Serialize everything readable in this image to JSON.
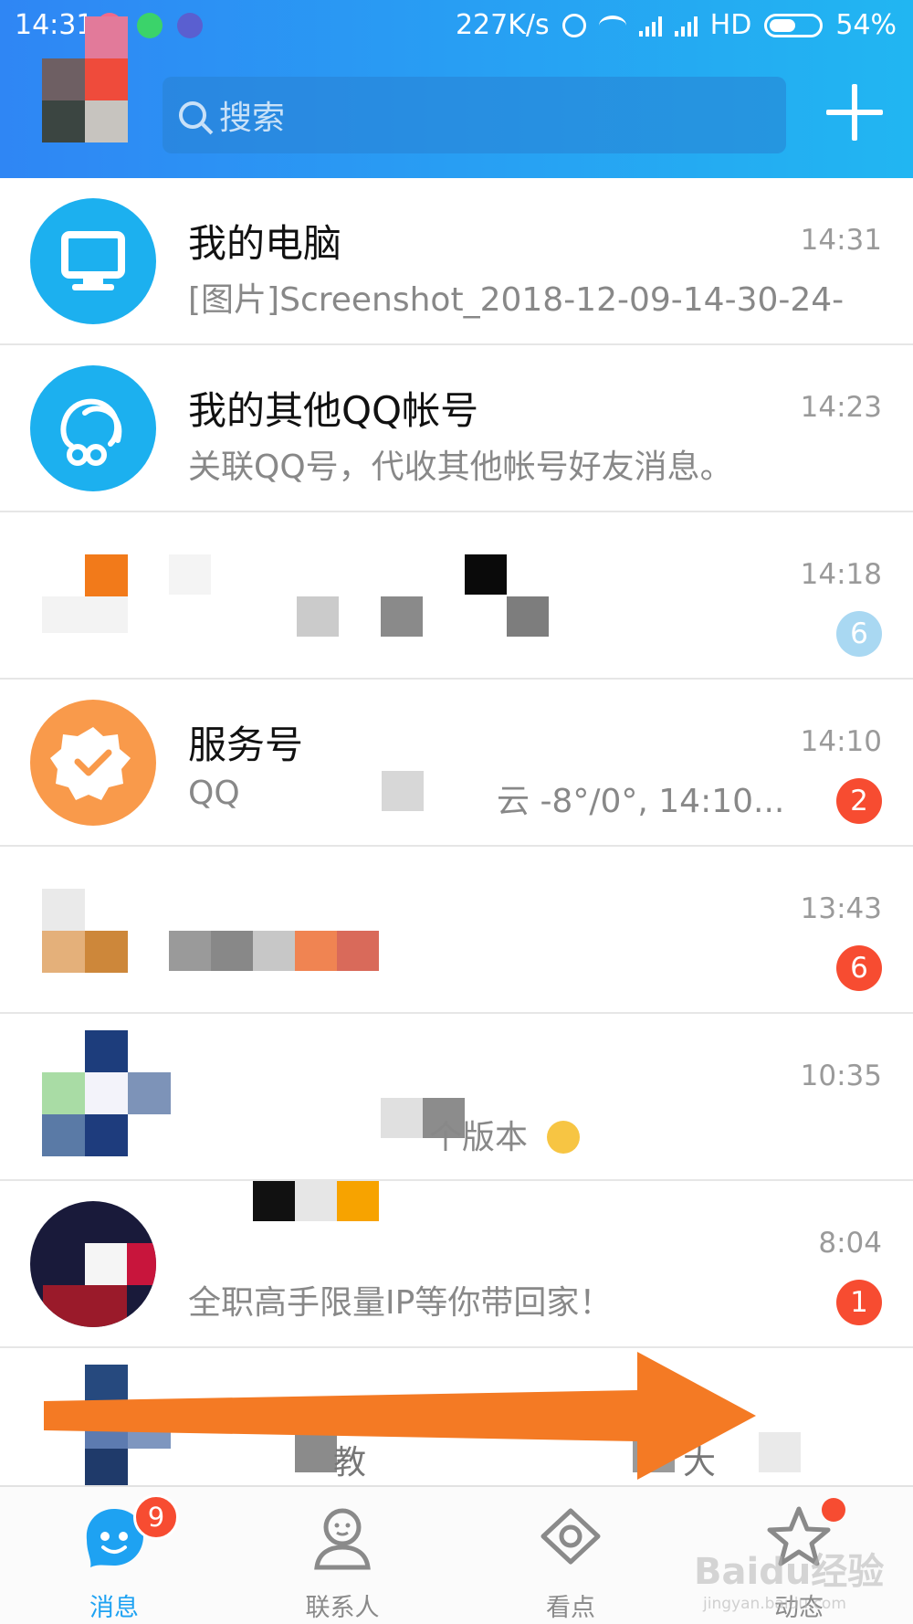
{
  "status_bar": {
    "time": "14:31",
    "net_speed": "227K/s",
    "hd": "HD",
    "battery": "54%",
    "battery_level": 0.54
  },
  "header": {
    "search_placeholder": "搜索"
  },
  "chats": [
    {
      "name": "我的电脑",
      "preview": "[图片]Screenshot_2018-12-09-14-30-24-...",
      "time": "14:31",
      "badge": "",
      "avatar_color": "#1cb0ef",
      "icon": "computer-icon"
    },
    {
      "name": "我的其他QQ帐号",
      "preview": "关联QQ号，代收其他帐号好友消息。",
      "time": "14:23",
      "badge": "",
      "avatar_color": "#1cb0ef",
      "icon": "linked-accounts-icon"
    },
    {
      "name": "",
      "preview": "",
      "time": "14:18",
      "badge": "6",
      "badge_muted": true
    },
    {
      "name": "服务号",
      "preview": "QQ",
      "preview_tail": "云 -8°/0°, 14:10...",
      "time": "14:10",
      "badge": "2",
      "avatar_color": "#f99a4b",
      "icon": "badge-check-icon"
    },
    {
      "name": "",
      "preview": "",
      "time": "13:43",
      "badge": "6"
    },
    {
      "name": "",
      "preview": "个版本",
      "time": "10:35",
      "badge": ""
    },
    {
      "name": "",
      "preview": "全职高手限量IP等你带回家！",
      "time": "8:04",
      "badge": "1"
    },
    {
      "name": "",
      "preview": "教",
      "preview_tail": "大",
      "time": "",
      "badge": ""
    }
  ],
  "tabs": [
    {
      "label": "消息",
      "active": true,
      "badge": "9"
    },
    {
      "label": "联系人",
      "active": false
    },
    {
      "label": "看点",
      "active": false
    },
    {
      "label": "动态",
      "active": false,
      "dot": true
    }
  ],
  "watermark": {
    "brand": "Baidu经验",
    "url": "jingyan.baidu.com"
  }
}
